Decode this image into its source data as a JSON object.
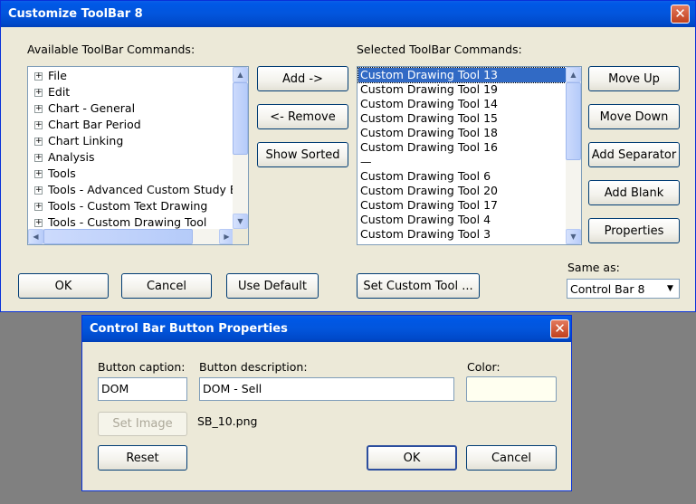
{
  "customize": {
    "title": "Customize ToolBar 8",
    "close_glyph": "✕",
    "available_label": "Available ToolBar Commands:",
    "selected_label": "Selected ToolBar Commands:",
    "available_items": [
      "File",
      "Edit",
      "Chart - General",
      "Chart Bar Period",
      "Chart Linking",
      "Analysis",
      "Tools",
      "Tools - Advanced Custom Study B",
      "Tools - Custom Text Drawing",
      "Tools - Custom Drawing Tool"
    ],
    "selected_items": [
      "Custom Drawing Tool 13",
      "Custom Drawing Tool 19",
      "Custom Drawing Tool 14",
      "Custom Drawing Tool 15",
      "Custom Drawing Tool 18",
      "Custom Drawing Tool 16",
      "—",
      "Custom Drawing Tool 6",
      "Custom Drawing Tool 20",
      "Custom Drawing Tool 17",
      "Custom Drawing Tool 4",
      "Custom Drawing Tool 3"
    ],
    "buttons": {
      "add": "Add ->",
      "remove": "<- Remove",
      "show_sorted": "Show Sorted",
      "move_up": "Move Up",
      "move_down": "Move Down",
      "add_separator": "Add Separator",
      "add_blank": "Add Blank",
      "properties": "Properties",
      "ok": "OK",
      "cancel": "Cancel",
      "use_default": "Use Default",
      "set_custom_tool": "Set Custom Tool ..."
    },
    "same_as_label": "Same as:",
    "same_as_value": "Control Bar 8"
  },
  "props": {
    "title": "Control Bar Button Properties",
    "close_glyph": "✕",
    "caption_label": "Button caption:",
    "caption_value": "DOM",
    "description_label": "Button description:",
    "description_value": "DOM - Sell",
    "color_label": "Color:",
    "color_value": "#FFFFF0",
    "set_image": "Set Image",
    "image_file": "SB_10.png",
    "reset": "Reset",
    "ok": "OK",
    "cancel": "Cancel"
  }
}
